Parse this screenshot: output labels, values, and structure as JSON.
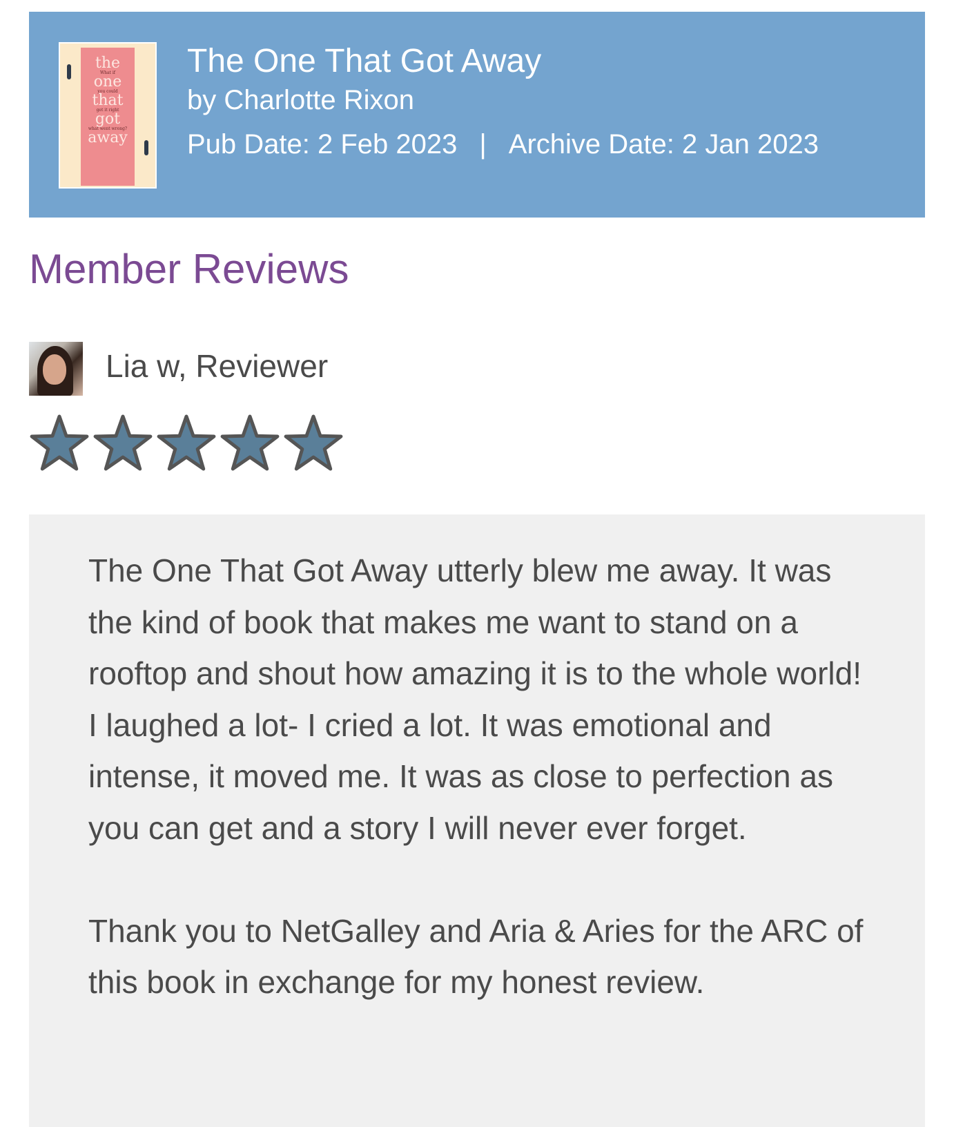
{
  "book": {
    "title": "The One That Got Away",
    "author": "by Charlotte Rixon",
    "pub_date": "Pub Date: 2 Feb 2023",
    "separator": "|",
    "archive_date": "Archive Date: 2 Jan 2023",
    "cover": {
      "words": [
        "the",
        "one",
        "that",
        "got",
        "away"
      ],
      "small_lines": [
        "What if",
        "you could",
        "get it right",
        "what went wrong?"
      ]
    }
  },
  "section": {
    "title": "Member Reviews"
  },
  "review": {
    "reviewer": "Lia w, Reviewer",
    "rating": 5,
    "rating_max": 5,
    "paragraphs": [
      "The One That Got Away  utterly blew me away. It was the kind of book that makes me want to stand on a rooftop and shout how amazing it is to the whole world! I laughed a lot- I cried a lot. It was emotional and intense, it moved me. It was as close to perfection as you can get and a story I will never ever forget.",
      "Thank you to NetGalley and  Aria & Aries  for the ARC of this book in exchange for my honest review."
    ]
  },
  "colors": {
    "header_bg": "#74a4cf",
    "section_title": "#7b4a93",
    "star_fill": "#5a7f99",
    "star_stroke": "#555555",
    "review_bg": "#f0f0f0",
    "body_text": "#4a4a4a"
  },
  "icons": {
    "star": "star-icon",
    "avatar": "reviewer-avatar"
  }
}
